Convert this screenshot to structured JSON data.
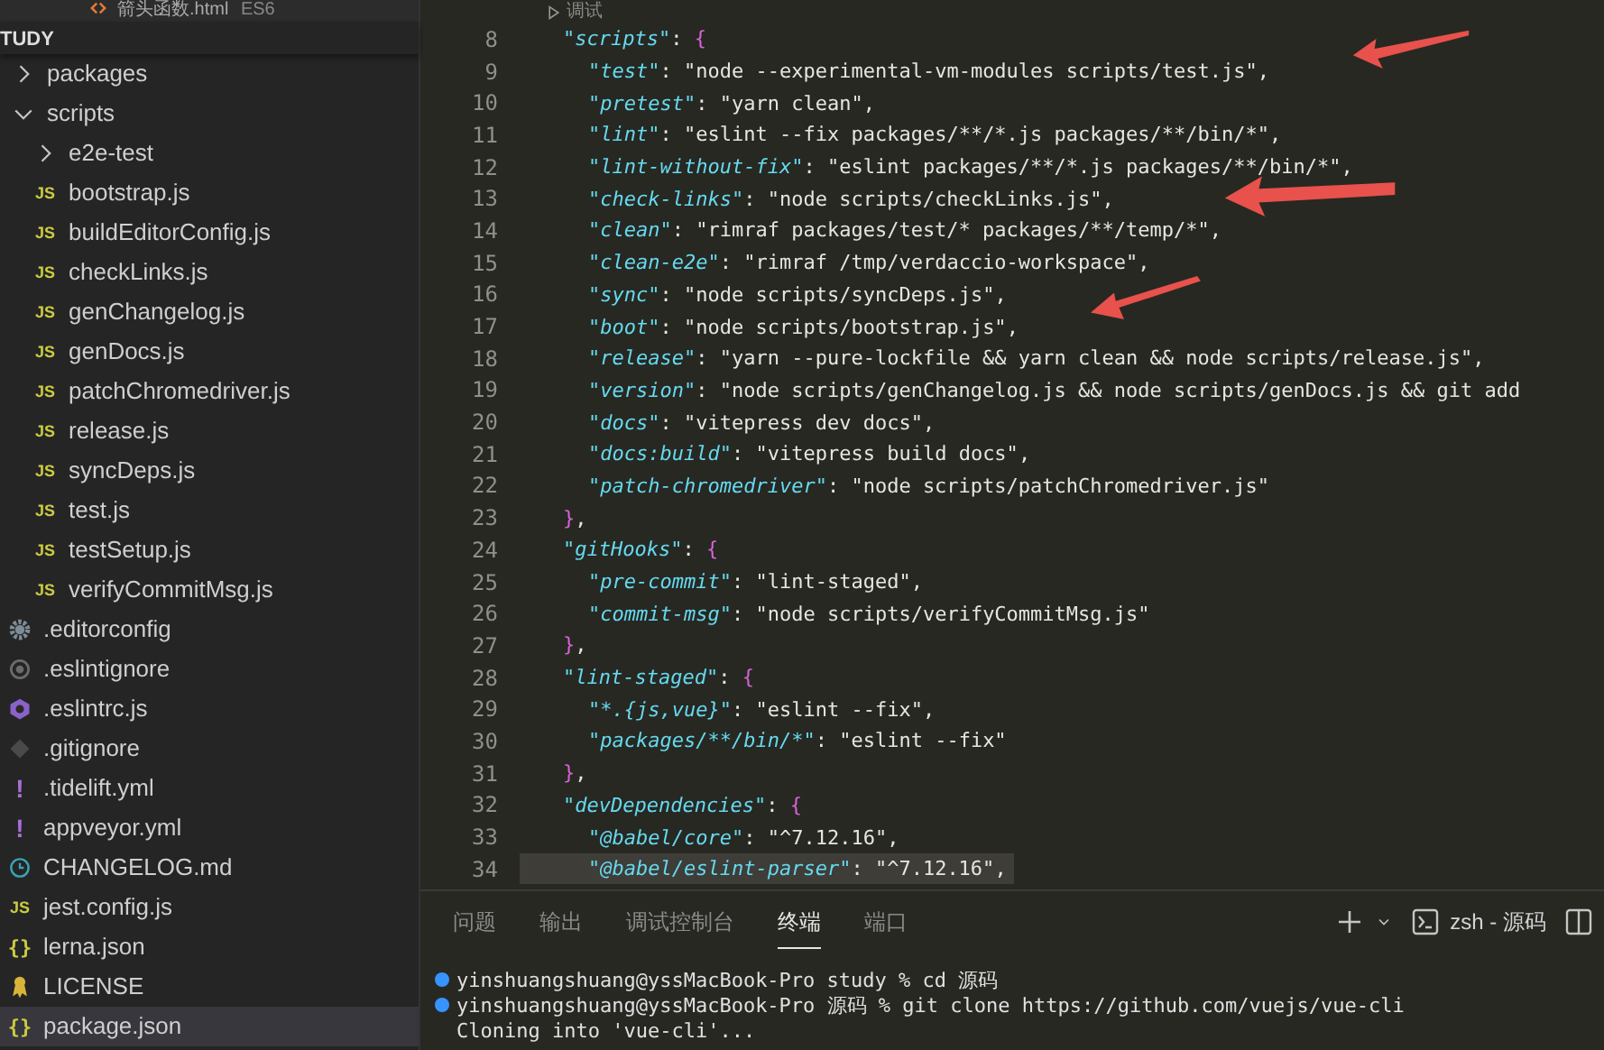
{
  "open_tab": {
    "name": "箭头函数.html",
    "tag": "ES6"
  },
  "explorer": {
    "section": "TUDY",
    "items": [
      {
        "name": "packages",
        "kind": "folder",
        "expanded": false,
        "selected": false
      },
      {
        "name": "scripts",
        "kind": "folder",
        "expanded": true,
        "selected": false,
        "children": [
          {
            "name": "e2e-test",
            "kind": "folder",
            "expanded": false,
            "selected": false
          },
          {
            "name": "bootstrap.js",
            "kind": "js",
            "icon": "JS",
            "selected": false
          },
          {
            "name": "buildEditorConfig.js",
            "kind": "js",
            "icon": "JS",
            "selected": false
          },
          {
            "name": "checkLinks.js",
            "kind": "js",
            "icon": "JS",
            "selected": false
          },
          {
            "name": "genChangelog.js",
            "kind": "js",
            "icon": "JS",
            "selected": false
          },
          {
            "name": "genDocs.js",
            "kind": "js",
            "icon": "JS",
            "selected": false
          },
          {
            "name": "patchChromedriver.js",
            "kind": "js",
            "icon": "JS",
            "selected": false
          },
          {
            "name": "release.js",
            "kind": "js",
            "icon": "JS",
            "selected": false
          },
          {
            "name": "syncDeps.js",
            "kind": "js",
            "icon": "JS",
            "selected": false
          },
          {
            "name": "test.js",
            "kind": "js",
            "icon": "JS",
            "selected": false
          },
          {
            "name": "testSetup.js",
            "kind": "js",
            "icon": "JS",
            "selected": false
          },
          {
            "name": "verifyCommitMsg.js",
            "kind": "js",
            "icon": "JS",
            "selected": false
          }
        ]
      },
      {
        "name": ".editorconfig",
        "kind": "gear",
        "selected": false
      },
      {
        "name": ".eslintignore",
        "kind": "ignore",
        "selected": false
      },
      {
        "name": ".eslintrc.js",
        "kind": "eslint",
        "selected": false
      },
      {
        "name": ".gitignore",
        "kind": "git",
        "selected": false
      },
      {
        "name": ".tidelift.yml",
        "kind": "yaml",
        "icon": "!",
        "selected": false
      },
      {
        "name": "appveyor.yml",
        "kind": "yaml",
        "icon": "!",
        "selected": false
      },
      {
        "name": "CHANGELOG.md",
        "kind": "clock",
        "selected": false
      },
      {
        "name": "jest.config.js",
        "kind": "js",
        "icon": "JS",
        "selected": false
      },
      {
        "name": "lerna.json",
        "kind": "json",
        "icon": "{}",
        "selected": false
      },
      {
        "name": "LICENSE",
        "kind": "license",
        "selected": false
      },
      {
        "name": "package.json",
        "kind": "json",
        "icon": "{}",
        "selected": true
      }
    ]
  },
  "editor": {
    "codelens": "调试",
    "lines": [
      {
        "num": "8",
        "key": "\"scripts\":",
        "open": "{",
        "close_num": "23",
        "close": "},",
        "children": [
          {
            "num": "9",
            "key": "\"test\":",
            "value": "\"node --experimental-vm-modules scripts/test.js\"",
            "tail": ","
          },
          {
            "num": "10",
            "key": "\"pretest\":",
            "value": "\"yarn clean\"",
            "tail": ","
          },
          {
            "num": "11",
            "key": "\"lint\":",
            "value": "\"eslint --fix packages/**/*.js packages/**/bin/*\"",
            "tail": ","
          },
          {
            "num": "12",
            "key": "\"lint-without-fix\":",
            "value": "\"eslint packages/**/*.js packages/**/bin/*\"",
            "tail": ","
          },
          {
            "num": "13",
            "key": "\"check-links\":",
            "value": "\"node scripts/checkLinks.js\"",
            "tail": ","
          },
          {
            "num": "14",
            "key": "\"clean\":",
            "value": "\"rimraf packages/test/* packages/**/temp/*\"",
            "tail": ","
          },
          {
            "num": "15",
            "key": "\"clean-e2e\":",
            "value": "\"rimraf /tmp/verdaccio-workspace\"",
            "tail": ","
          },
          {
            "num": "16",
            "key": "\"sync\":",
            "value": "\"node scripts/syncDeps.js\"",
            "tail": ","
          },
          {
            "num": "17",
            "key": "\"boot\":",
            "value": "\"node scripts/bootstrap.js\"",
            "tail": ","
          },
          {
            "num": "18",
            "key": "\"release\":",
            "value": "\"yarn --pure-lockfile && yarn clean && node scripts/release.js\"",
            "tail": ","
          },
          {
            "num": "19",
            "key": "\"version\":",
            "value": "\"node scripts/genChangelog.js && node scripts/genDocs.js && git add"
          },
          {
            "num": "20",
            "key": "\"docs\":",
            "value": "\"vitepress dev docs\"",
            "tail": ","
          },
          {
            "num": "21",
            "key": "\"docs:build\":",
            "value": "\"vitepress build docs\"",
            "tail": ","
          },
          {
            "num": "22",
            "key": "\"patch-chromedriver\":",
            "value": "\"node scripts/patchChromedriver.js\""
          }
        ]
      },
      {
        "num": "24",
        "key": "\"gitHooks\":",
        "open": "{",
        "close_num": "27",
        "close": "},",
        "children": [
          {
            "num": "25",
            "key": "\"pre-commit\":",
            "value": "\"lint-staged\"",
            "tail": ","
          },
          {
            "num": "26",
            "key": "\"commit-msg\":",
            "value": "\"node scripts/verifyCommitMsg.js\""
          }
        ]
      },
      {
        "num": "28",
        "key": "\"lint-staged\":",
        "open": "{",
        "close_num": "31",
        "close": "},",
        "children": [
          {
            "num": "29",
            "key": "\"*.{js,vue}\":",
            "value": "\"eslint --fix\"",
            "tail": ","
          },
          {
            "num": "30",
            "key": "\"packages/**/bin/*\":",
            "value": "\"eslint --fix\""
          }
        ]
      },
      {
        "num": "32",
        "key": "\"devDependencies\":",
        "open": "{",
        "children": [
          {
            "num": "33",
            "key": "\"@babel/core\":",
            "value": "\"^7.12.16\"",
            "tail": ",",
            "current": false
          },
          {
            "num": "34",
            "key": "\"@babel/eslint-parser\":",
            "value": "\"^7.12.16\"",
            "tail": ",",
            "current": true
          }
        ]
      }
    ]
  },
  "panel": {
    "tabs": [
      {
        "label": "问题",
        "selected": false
      },
      {
        "label": "输出",
        "selected": false
      },
      {
        "label": "调试控制台",
        "selected": false
      },
      {
        "label": "终端",
        "selected": true
      },
      {
        "label": "端口",
        "selected": false
      }
    ],
    "terminal_name": "zsh - 源码",
    "terminal_lines": [
      {
        "text": "yinshuangshuang@yssMacBook-Pro study % cd 源码",
        "dot": true
      },
      {
        "text": "yinshuangshuang@yssMacBook-Pro 源码 % git clone https://github.com/vuejs/vue-cli",
        "dot": true
      },
      {
        "text": "Cloning into 'vue-cli'...",
        "dot": false
      }
    ]
  }
}
